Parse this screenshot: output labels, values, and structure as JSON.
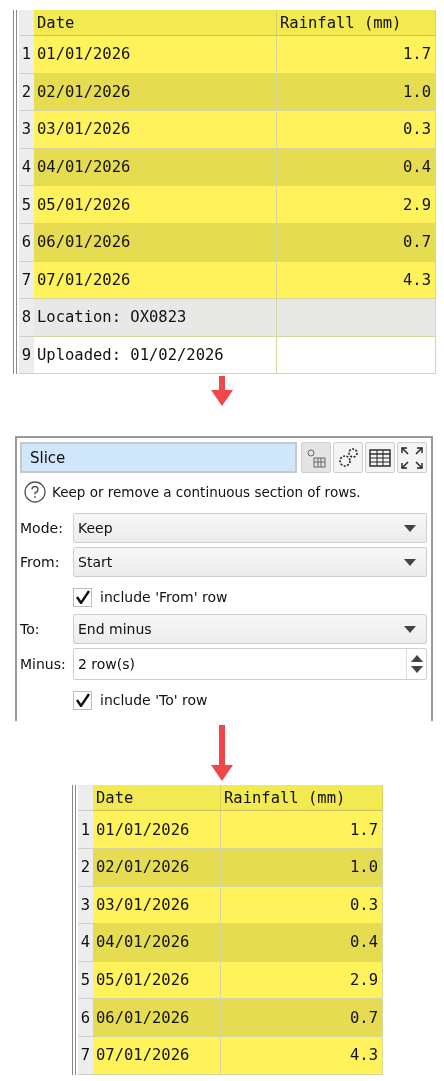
{
  "input_table": {
    "header_highlighted": true,
    "columns": [
      "Date",
      "Rainfall (mm)"
    ],
    "rows": [
      {
        "number": "1",
        "cells": [
          "01/01/2026",
          "1.7"
        ],
        "highlighted": true
      },
      {
        "number": "2",
        "cells": [
          "02/01/2026",
          "1.0"
        ],
        "highlighted": true
      },
      {
        "number": "3",
        "cells": [
          "03/01/2026",
          "0.3"
        ],
        "highlighted": true
      },
      {
        "number": "4",
        "cells": [
          "04/01/2026",
          "0.4"
        ],
        "highlighted": true
      },
      {
        "number": "5",
        "cells": [
          "05/01/2026",
          "2.9"
        ],
        "highlighted": true
      },
      {
        "number": "6",
        "cells": [
          "06/01/2026",
          "0.7"
        ],
        "highlighted": true
      },
      {
        "number": "7",
        "cells": [
          "07/01/2026",
          "4.3"
        ],
        "highlighted": true
      },
      {
        "number": "8",
        "cells": [
          "Location: OX0823",
          ""
        ],
        "highlighted": false
      },
      {
        "number": "9",
        "cells": [
          "Uploaded: 01/02/2026",
          ""
        ],
        "highlighted": false
      }
    ]
  },
  "slice_panel": {
    "title": "Slice",
    "help": "Keep or remove a continuous section of rows.",
    "fields": [
      {
        "kind": "dropdown",
        "label": "Mode:",
        "value": "Keep"
      },
      {
        "kind": "dropdown",
        "label": "From:",
        "value": "Start"
      },
      {
        "kind": "checkbox",
        "label": "include 'From' row",
        "checked": true
      },
      {
        "kind": "dropdown",
        "label": "To:",
        "value": "End minus"
      },
      {
        "kind": "spinner",
        "label": "Minus:",
        "value": "2 row(s)"
      },
      {
        "kind": "checkbox",
        "label": "include 'To' row",
        "checked": true
      }
    ]
  },
  "output_table": {
    "header_highlighted": true,
    "columns": [
      "Date",
      "Rainfall (mm)"
    ],
    "rows": [
      {
        "number": "1",
        "cells": [
          "01/01/2026",
          "1.7"
        ],
        "highlighted": true
      },
      {
        "number": "2",
        "cells": [
          "02/01/2026",
          "1.0"
        ],
        "highlighted": true
      },
      {
        "number": "3",
        "cells": [
          "03/01/2026",
          "0.3"
        ],
        "highlighted": true
      },
      {
        "number": "4",
        "cells": [
          "04/01/2026",
          "0.4"
        ],
        "highlighted": true
      },
      {
        "number": "5",
        "cells": [
          "05/01/2026",
          "2.9"
        ],
        "highlighted": true
      },
      {
        "number": "6",
        "cells": [
          "06/01/2026",
          "0.7"
        ],
        "highlighted": true
      },
      {
        "number": "7",
        "cells": [
          "07/01/2026",
          "4.3"
        ],
        "highlighted": true
      }
    ]
  }
}
